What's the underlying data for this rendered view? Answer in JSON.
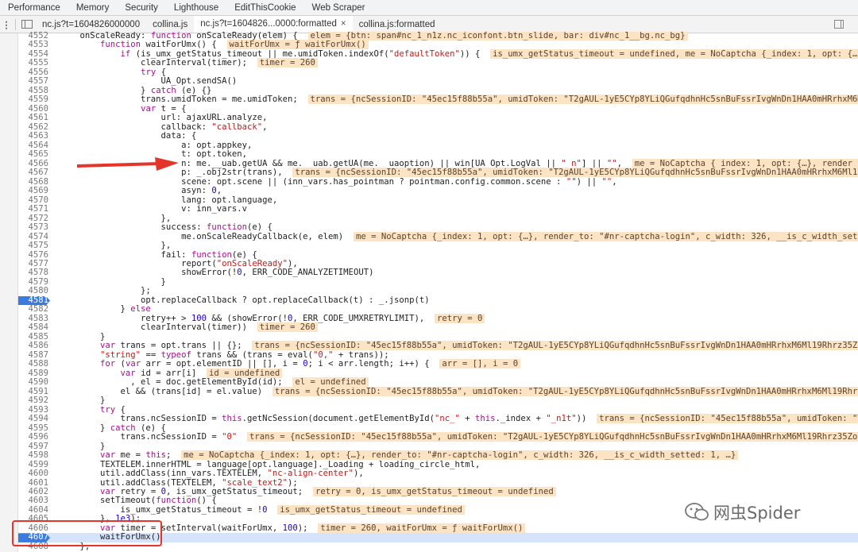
{
  "devtools_tabs": [
    "Performance",
    "Memory",
    "Security",
    "Lighthouse",
    "EditThisCookie",
    "Web Scraper"
  ],
  "file_tabs": [
    {
      "label": "nc.js?t=1604826000000",
      "active": false
    },
    {
      "label": "collina.js",
      "active": false
    },
    {
      "label": "nc.js?t=1604826...0000:formatted",
      "active": true,
      "close": "×"
    },
    {
      "label": "collina.js:formatted",
      "active": false
    }
  ],
  "colors": {
    "breakpoint": "#3a7be0",
    "inline_value_bg": "#fbe3c4",
    "annotation_red": "#e5352b"
  },
  "breakpoints": [
    "4581",
    "4607"
  ],
  "watermark": "网虫Spider",
  "code_lines": [
    {
      "num": "4552",
      "text": "    onScaleReady: function onScaleReady(elem) {  elem = {btn: span#nc_1_n1z.nc_iconfont.btn_slide, bar: div#nc_1__bg.nc_bg}"
    },
    {
      "num": "4553",
      "text": "        function waitForUmx() {  waitForUmx = ƒ waitForUmx()"
    },
    {
      "num": "4554",
      "text": "            if (is_umx_getStatus_timeout || me.umidToken.indexOf(\"defaultToken\")) {  is_umx_getStatus_timeout = undefined, me = NoCaptcha {_index: 1, opt: {…}, rend"
    },
    {
      "num": "4555",
      "text": "                clearInterval(timer);  timer = 260"
    },
    {
      "num": "4556",
      "text": "                try {"
    },
    {
      "num": "4557",
      "text": "                    UA_Opt.sendSA()"
    },
    {
      "num": "4558",
      "text": "                } catch (e) {}"
    },
    {
      "num": "4559",
      "text": "                trans.umidToken = me.umidToken;  trans = {ncSessionID: \"45ec15f88b55a\", umidToken: \"T2gAUL-1yE5CYp8YLiQGufqdhnHc5snBuFssrIvgWnDn1HAA0mHRrhxM6M"
    },
    {
      "num": "4560",
      "text": "                var t = {"
    },
    {
      "num": "4561",
      "text": "                    url: ajaxURL.analyze,"
    },
    {
      "num": "4562",
      "text": "                    callback: \"callback\","
    },
    {
      "num": "4563",
      "text": "                    data: {"
    },
    {
      "num": "4564",
      "text": "                        a: opt.appkey,"
    },
    {
      "num": "4565",
      "text": "                        t: opt.token,"
    },
    {
      "num": "4566",
      "text": "                        n: me.__uab.getUA && me.__uab.getUA(me.__uaoption) || win[UA_Opt.LogVal || \"_n\"] || \"\",  me = NoCaptcha {_index: 1, opt: {…}, render_to"
    },
    {
      "num": "4567",
      "text": "                        p: _.obj2str(trans),  trans = {ncSessionID: \"45ec15f88b55a\", umidToken: \"T2gAUL-1yE5CYp8YLiQGufqdhnHc5snBuFssrIvgWnDn1HAA0mHRrhxM6Ml19R"
    },
    {
      "num": "4568",
      "text": "                        scene: opt.scene || (inn_vars.has_pointman ? pointman.config.common.scene : \"\") || \"\","
    },
    {
      "num": "4569",
      "text": "                        asyn: 0,"
    },
    {
      "num": "4570",
      "text": "                        lang: opt.language,"
    },
    {
      "num": "4571",
      "text": "                        v: inn_vars.v"
    },
    {
      "num": "4572",
      "text": "                    },"
    },
    {
      "num": "4573",
      "text": "                    success: function(e) {"
    },
    {
      "num": "4574",
      "text": "                        me.onScaleReadyCallback(e, elem)  me = NoCaptcha {_index: 1, opt: {…}, render_to: \"#nr-captcha-login\", c_width: 326, __is_c_width_sette"
    },
    {
      "num": "4575",
      "text": "                    },"
    },
    {
      "num": "4576",
      "text": "                    fail: function(e) {"
    },
    {
      "num": "4577",
      "text": "                        report(\"onScaleReady\"),"
    },
    {
      "num": "4578",
      "text": "                        showError(!0, ERR_CODE_ANALYZETIMEOUT)"
    },
    {
      "num": "4579",
      "text": "                    }"
    },
    {
      "num": "4580",
      "text": "                };"
    },
    {
      "num": "4581",
      "text": "                opt.replaceCallback ? opt.replaceCallback(t) : _.jsonp(t)"
    },
    {
      "num": "4582",
      "text": "            } else"
    },
    {
      "num": "4583",
      "text": "                retry++ > 100 && (showError(!0, ERR_CODE_UMXRETRYLIMIT),  retry = 0"
    },
    {
      "num": "4584",
      "text": "                clearInterval(timer))  timer = 260"
    },
    {
      "num": "4585",
      "text": "        }"
    },
    {
      "num": "4586",
      "text": "        var trans = opt.trans || {};  trans = {ncSessionID: \"45ec15f88b55a\", umidToken: \"T2gAUL-1yE5CYp8YLiQGufqdhnHc5snBuFssrIvgWnDn1HAA0mHRrhxM6Ml19Rhrz35Zoz"
    },
    {
      "num": "4587",
      "text": "        \"string\" == typeof trans && (trans = eval(\"0,\" + trans));"
    },
    {
      "num": "4588",
      "text": "        for (var arr = opt.elementID || [], i = 0; i < arr.length; i++) {  arr = [], i = 0"
    },
    {
      "num": "4589",
      "text": "            var id = arr[i]  id = undefined"
    },
    {
      "num": "4590",
      "text": "              , el = doc.getElementById(id);  el = undefined"
    },
    {
      "num": "4591",
      "text": "            el && (trans[id] = el.value)  trans = {ncSessionID: \"45ec15f88b55a\", umidToken: \"T2gAUL-1yE5CYp8YLiQGufqdhnHc5snBuFssrIvgWnDn1HAA0mHRrhxM6Ml19Rhrz35"
    },
    {
      "num": "4592",
      "text": "        }"
    },
    {
      "num": "4593",
      "text": "        try {"
    },
    {
      "num": "4594",
      "text": "            trans.ncSessionID = this.getNcSession(document.getElementById(\"nc_\" + this._index + \"_n1t\"))  trans = {ncSessionID: \"45ec15f88b55a\", umidToken: \"T2"
    },
    {
      "num": "4595",
      "text": "        } catch (e) {"
    },
    {
      "num": "4596",
      "text": "            trans.ncSessionID = \"0\"  trans = {ncSessionID: \"45ec15f88b55a\", umidToken: \"T2gAUL-1yE5CYp8YLiQGufqdhnHc5snBuFssrIvgWnDn1HAA0mHRrhxM6Ml19Rhrz35Zoz"
    },
    {
      "num": "4597",
      "text": "        }"
    },
    {
      "num": "4598",
      "text": "        var me = this;  me = NoCaptcha {_index: 1, opt: {…}, render_to: \"#nr-captcha-login\", c_width: 326, __is_c_width_setted: 1, …}"
    },
    {
      "num": "4599",
      "text": "        TEXTELEM.innerHTML = language[opt.language]._Loading + loading_circle_html,"
    },
    {
      "num": "4600",
      "text": "        util.addClass(inn_vars.TEXTELEM, \"nc-align-center\"),"
    },
    {
      "num": "4601",
      "text": "        util.addClass(TEXTELEM, \"scale_text2\");"
    },
    {
      "num": "4602",
      "text": "        var retry = 0, is_umx_getStatus_timeout;  retry = 0, is_umx_getStatus_timeout = undefined"
    },
    {
      "num": "4603",
      "text": "        setTimeout(function() {"
    },
    {
      "num": "4604",
      "text": "            is_umx_getStatus_timeout = !0  is_umx_getStatus_timeout = undefined"
    },
    {
      "num": "4605",
      "text": "        }, 1e3);"
    },
    {
      "num": "4606",
      "text": "        var timer = setInterval(waitForUmx, 100);  timer = 260, waitForUmx = ƒ waitForUmx()"
    },
    {
      "num": "4607",
      "text": "        waitForUmx()"
    },
    {
      "num": "4608",
      "text": "    },"
    }
  ]
}
